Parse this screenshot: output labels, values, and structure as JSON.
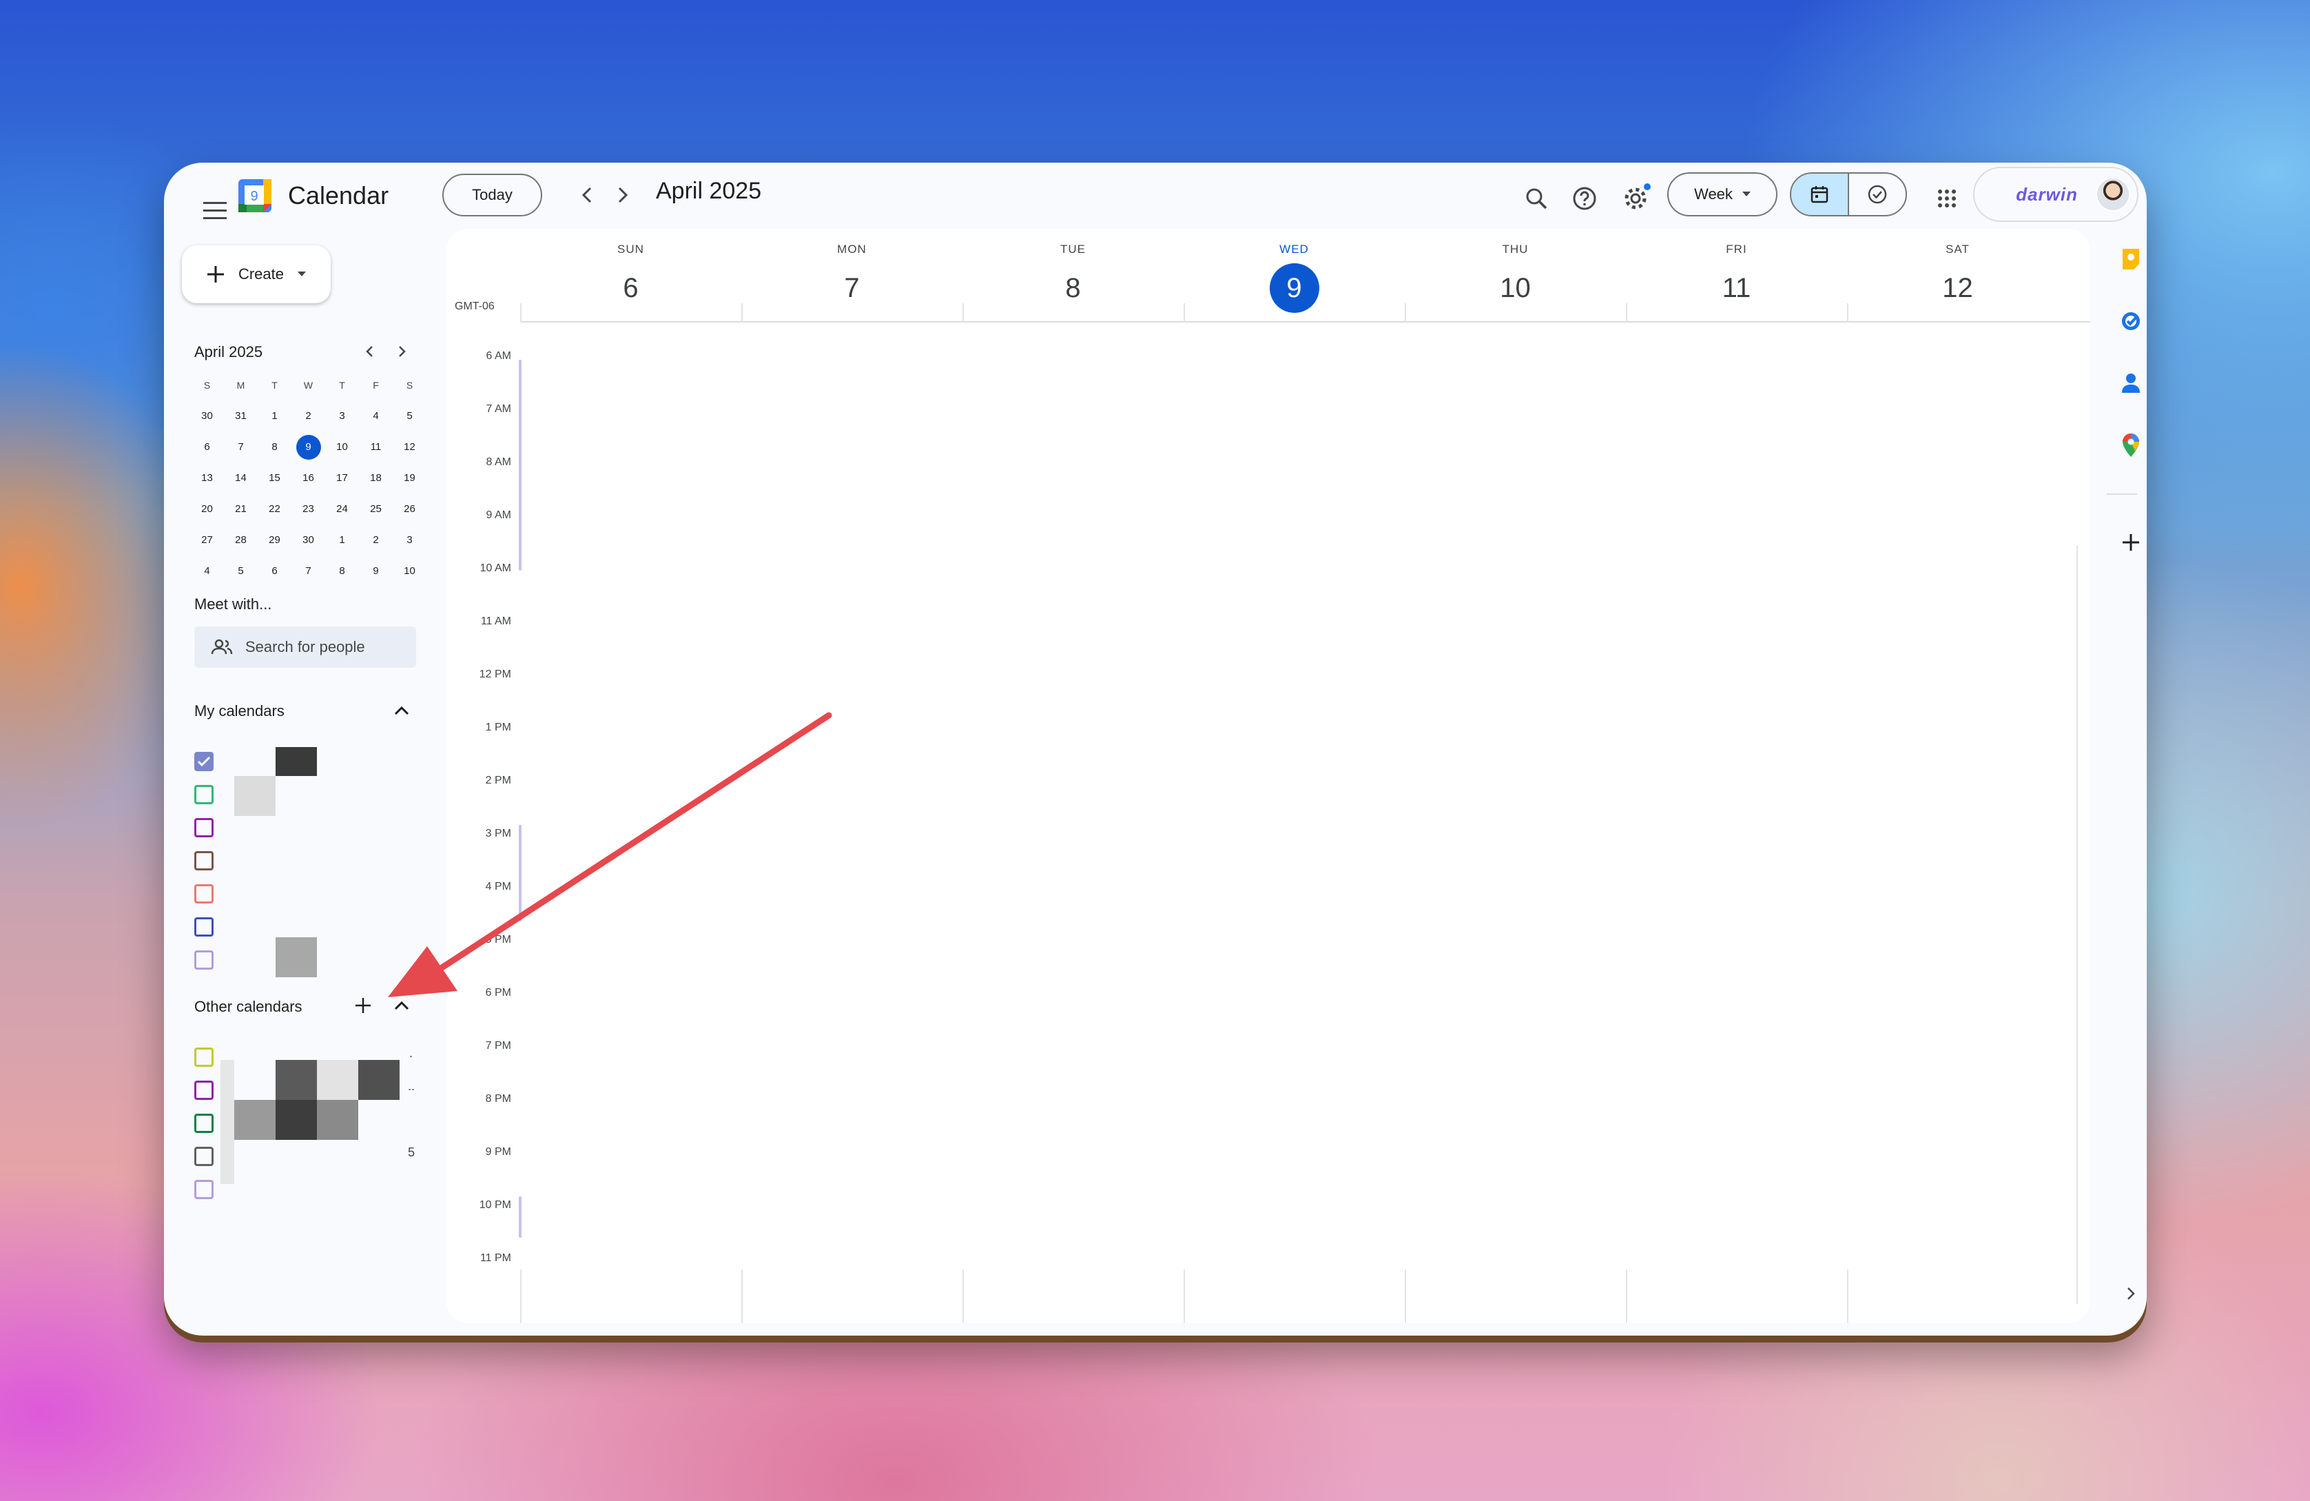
{
  "app": {
    "title": "Calendar",
    "logo_day": "9"
  },
  "toolbar": {
    "today_label": "Today",
    "month_title": "April 2025",
    "view_label": "Week",
    "brand": "darwin"
  },
  "sidebar": {
    "create_label": "Create",
    "mini_calendar": {
      "title": "April 2025",
      "weekdays": [
        "S",
        "M",
        "T",
        "W",
        "T",
        "F",
        "S"
      ],
      "weeks": [
        [
          "30",
          "31",
          "1",
          "2",
          "3",
          "4",
          "5"
        ],
        [
          "6",
          "7",
          "8",
          "9",
          "10",
          "11",
          "12"
        ],
        [
          "13",
          "14",
          "15",
          "16",
          "17",
          "18",
          "19"
        ],
        [
          "20",
          "21",
          "22",
          "23",
          "24",
          "25",
          "26"
        ],
        [
          "27",
          "28",
          "29",
          "30",
          "1",
          "2",
          "3"
        ],
        [
          "4",
          "5",
          "6",
          "7",
          "8",
          "9",
          "10"
        ]
      ],
      "today": "9"
    },
    "meet_with_label": "Meet with...",
    "search_people_placeholder": "Search for people",
    "my_calendars_label": "My calendars",
    "other_calendars_label": "Other calendars",
    "my_calendars": [
      {
        "color": "#7986cb",
        "checked": true
      },
      {
        "color": "#33b679",
        "checked": false
      },
      {
        "color": "#8e24aa",
        "checked": false
      },
      {
        "color": "#795548",
        "checked": false
      },
      {
        "color": "#e67c73",
        "checked": false
      },
      {
        "color": "#3f51b5",
        "checked": false
      },
      {
        "color": "#b39ddb",
        "checked": false
      }
    ],
    "other_calendars": [
      {
        "color": "#c0ca33",
        "checked": false
      },
      {
        "color": "#8e24aa",
        "checked": false
      },
      {
        "color": "#0b8043",
        "checked": false
      },
      {
        "color": "#616161",
        "checked": false
      },
      {
        "color": "#b39ddb",
        "checked": false
      }
    ],
    "other_calendar_fragments": [
      ".",
      "..",
      "5"
    ]
  },
  "week": {
    "timezone": "GMT-06",
    "days": [
      {
        "name": "SUN",
        "num": "6"
      },
      {
        "name": "MON",
        "num": "7"
      },
      {
        "name": "TUE",
        "num": "8"
      },
      {
        "name": "WED",
        "num": "9",
        "current": true
      },
      {
        "name": "THU",
        "num": "10"
      },
      {
        "name": "FRI",
        "num": "11"
      },
      {
        "name": "SAT",
        "num": "12"
      }
    ],
    "hours": [
      "6 AM",
      "7 AM",
      "8 AM",
      "9 AM",
      "10 AM",
      "11 AM",
      "12 PM",
      "1 PM",
      "2 PM",
      "3 PM",
      "4 PM",
      "5 PM",
      "6 PM",
      "7 PM",
      "8 PM",
      "9 PM",
      "10 PM",
      "11 PM"
    ]
  },
  "side_panel": {
    "icons": [
      "keep-icon",
      "tasks-icon",
      "contacts-icon",
      "maps-icon",
      "add-icon",
      "expand-icon"
    ]
  },
  "colors": {
    "accent": "#0b57d0",
    "annotation_arrow": "#e5484d"
  }
}
